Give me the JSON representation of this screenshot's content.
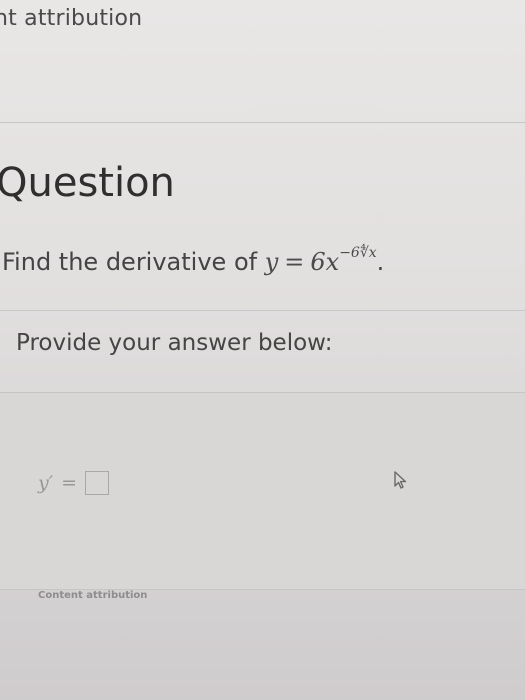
{
  "top_attribution": "nt attribution",
  "question": {
    "heading": "Question",
    "text_prefix": "Find the derivative of ",
    "equation": {
      "lhs": "y",
      "operator": "=",
      "rhs_coefficient": "6x",
      "rhs_exponent": "−6∜x"
    },
    "trailing": "."
  },
  "answer": {
    "prompt": "Provide your answer below:",
    "variable": "y′",
    "operator": "=",
    "input_value": ""
  },
  "icons": {
    "cursor": "mouse-pointer-icon"
  },
  "bottom_attribution": "Content attribution"
}
